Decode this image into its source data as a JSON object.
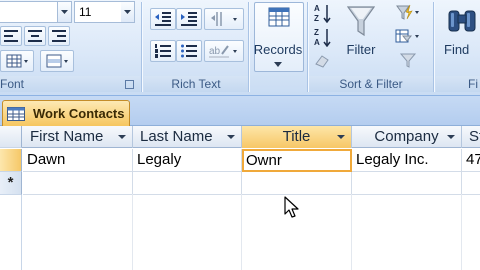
{
  "ribbon": {
    "font_group": {
      "label": "Font",
      "font_size_value": "11"
    },
    "rich_text_group": {
      "label": "Rich Text"
    },
    "records_group": {
      "button_label": "Records"
    },
    "sort_filter_group": {
      "label": "Sort & Filter",
      "filter_label": "Filter"
    },
    "find_group": {
      "button_label": "Find",
      "label_partial": "Fi"
    }
  },
  "document_tab": {
    "label": "Work Contacts"
  },
  "datasheet": {
    "columns": [
      "First Name",
      "Last Name",
      "Title",
      "Company",
      "St"
    ],
    "active_column": 2,
    "rows": [
      {
        "first_name": "Dawn",
        "last_name": "Legaly",
        "title": "Ownr",
        "company": "Legaly Inc.",
        "extra": "47"
      }
    ],
    "new_record_marker": "*"
  }
}
